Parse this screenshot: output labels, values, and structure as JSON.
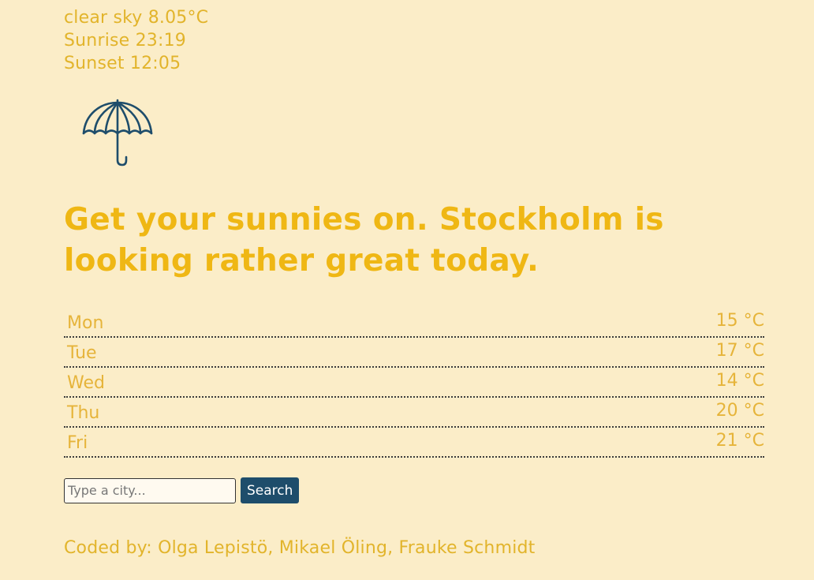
{
  "weather": {
    "description": "clear sky 8.05°C",
    "sunrise": "Sunrise 23:19",
    "sunset": "Sunset 12:05",
    "icon": "umbrella-icon"
  },
  "headline": "Get your sunnies on. Stockholm is looking rather great today.",
  "forecast": [
    {
      "day": "Mon",
      "temp": "15 °C"
    },
    {
      "day": "Tue",
      "temp": "17 °C"
    },
    {
      "day": "Wed",
      "temp": "14 °C"
    },
    {
      "day": "Thu",
      "temp": "20 °C"
    },
    {
      "day": "Fri",
      "temp": "21 °C"
    }
  ],
  "search": {
    "placeholder": "Type a city...",
    "value": "",
    "button_label": "Search"
  },
  "footer": "Coded by: Olga Lepistö, Mikael Öling, Frauke Schmidt",
  "colors": {
    "background": "#fbedc8",
    "accent": "#efb714",
    "button": "#1e4d6b",
    "icon": "#1e4d6b"
  }
}
